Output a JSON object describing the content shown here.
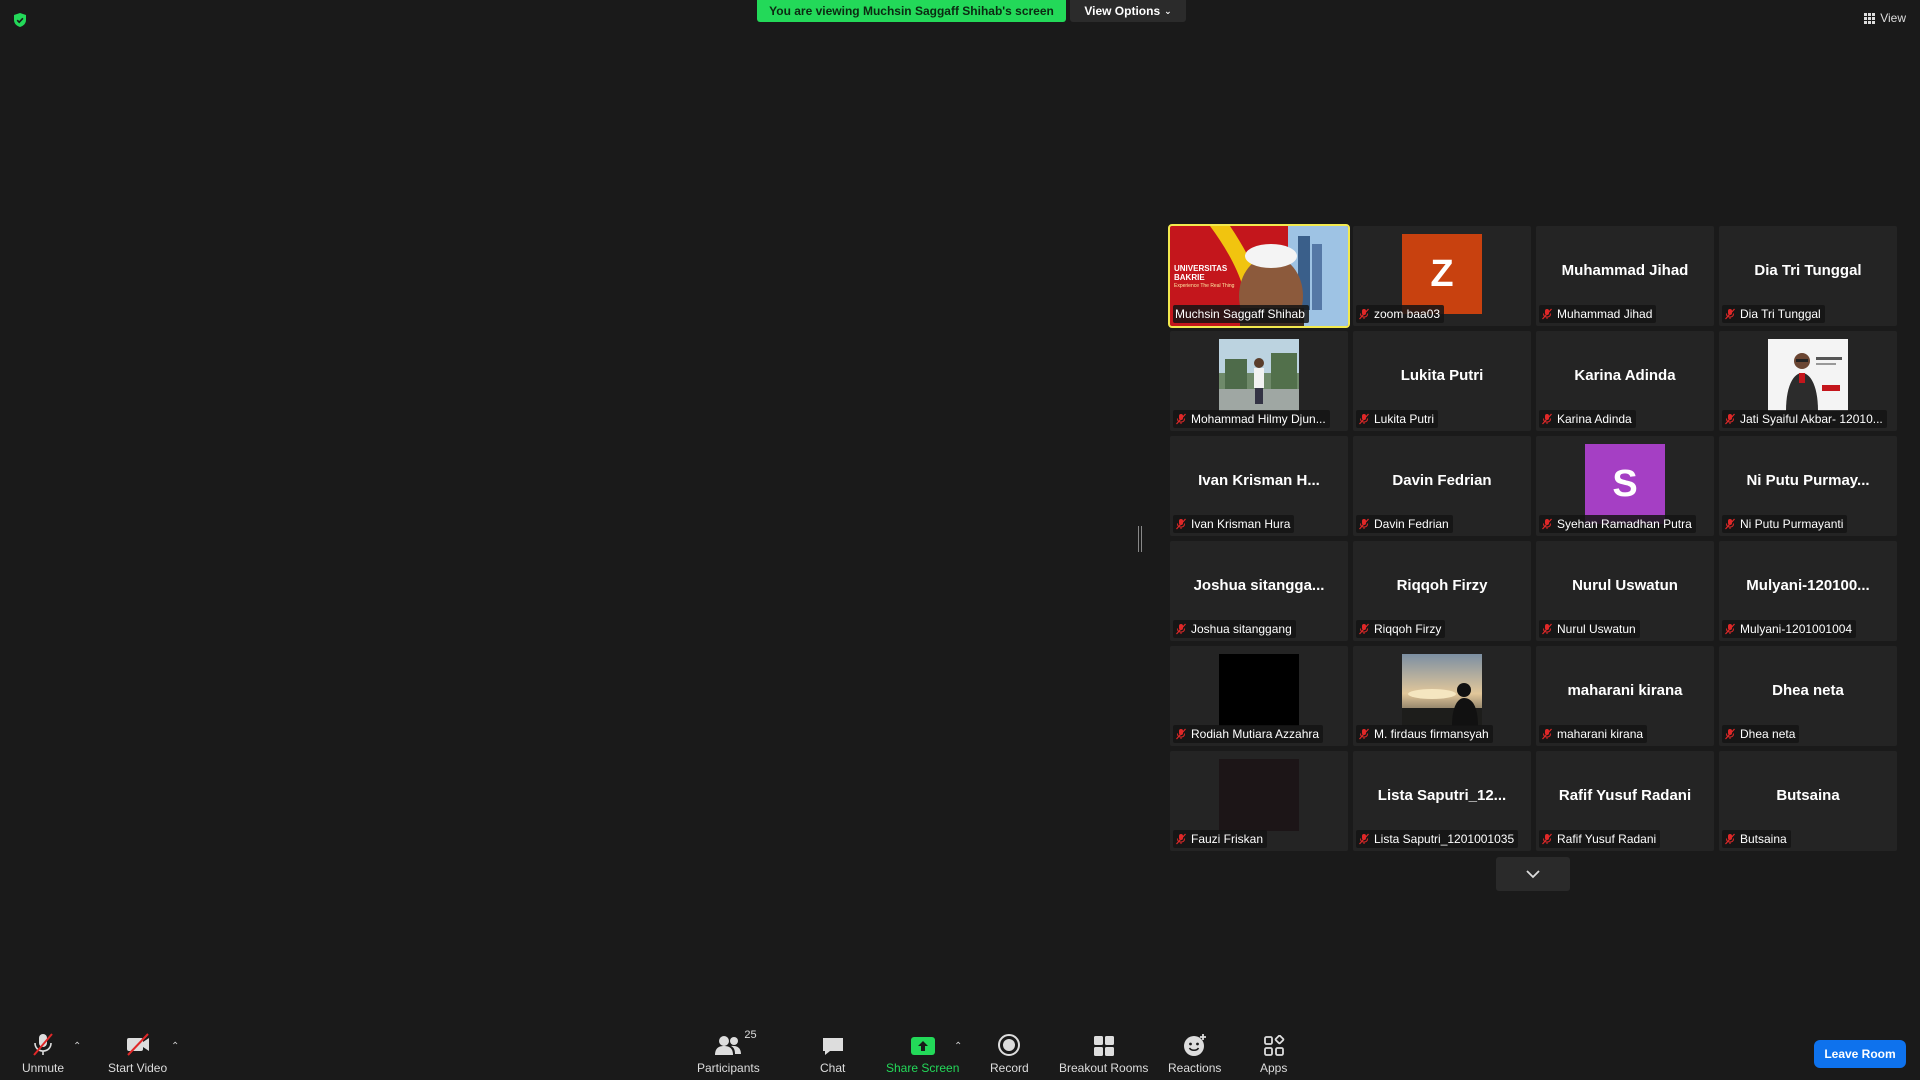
{
  "top": {
    "banner": "You are viewing Muchsin Saggaff Shihab's screen",
    "view_options": "View Options",
    "view": "View"
  },
  "gallery": {
    "tiles": [
      {
        "label": "Muchsin Saggaff Shihab",
        "big": "",
        "kind": "video",
        "muted": false
      },
      {
        "label": "zoom baa03",
        "big": "",
        "kind": "avatar",
        "letter": "Z",
        "avatar_color": "#c8410f",
        "muted": true
      },
      {
        "label": "Muhammad Jihad",
        "big": "Muhammad Jihad",
        "kind": "name",
        "muted": true
      },
      {
        "label": "Dia Tri Tunggal",
        "big": "Dia Tri Tunggal",
        "kind": "name",
        "muted": true
      },
      {
        "label": "Mohammad Hilmy Djun...",
        "big": "",
        "kind": "photo",
        "photo": "outdoor-person",
        "muted": true
      },
      {
        "label": "Lukita Putri",
        "big": "Lukita Putri",
        "kind": "name",
        "muted": true
      },
      {
        "label": "Karina Adinda",
        "big": "Karina Adinda",
        "kind": "name",
        "muted": true
      },
      {
        "label": "Jati Syaiful Akbar- 12010...",
        "big": "",
        "kind": "photo",
        "photo": "poster-person",
        "muted": true
      },
      {
        "label": "Ivan Krisman Hura",
        "big": "Ivan  Krisman  H...",
        "kind": "name",
        "muted": true
      },
      {
        "label": "Davin Fedrian",
        "big": "Davin Fedrian",
        "kind": "name",
        "muted": true
      },
      {
        "label": "Syehan Ramadhan Putra",
        "big": "",
        "kind": "avatar",
        "letter": "S",
        "avatar_color": "#a53fc4",
        "muted": true
      },
      {
        "label": "Ni Putu Purmayanti",
        "big": "Ni  Putu  Purmay...",
        "kind": "name",
        "muted": true
      },
      {
        "label": "Joshua sitanggang",
        "big": "Joshua  sitangga...",
        "kind": "name",
        "muted": true
      },
      {
        "label": "Riqqoh Firzy",
        "big": "Riqqoh Firzy",
        "kind": "name",
        "muted": true
      },
      {
        "label": "Nurul Uswatun",
        "big": "Nurul Uswatun",
        "kind": "name",
        "muted": true
      },
      {
        "label": "Mulyani-1201001004",
        "big": "Mulyani-120100...",
        "kind": "name",
        "muted": true
      },
      {
        "label": "Rodiah Mutiara Azzahra",
        "big": "",
        "kind": "photo",
        "photo": "black",
        "muted": true
      },
      {
        "label": "M. firdaus firmansyah",
        "big": "",
        "kind": "photo",
        "photo": "sunset-silhouette",
        "muted": true
      },
      {
        "label": "maharani kirana",
        "big": "maharani kirana",
        "kind": "name",
        "muted": true
      },
      {
        "label": "Dhea neta",
        "big": "Dhea neta",
        "kind": "name",
        "muted": true
      },
      {
        "label": "Fauzi Friskan",
        "big": "",
        "kind": "photo",
        "photo": "dark",
        "muted": true
      },
      {
        "label": "Lista Saputri_1201001035",
        "big": "Lista  Saputri_12...",
        "kind": "name",
        "muted": true
      },
      {
        "label": "Rafif Yusuf Radani",
        "big": "Rafif Yusuf Radani",
        "kind": "name",
        "muted": true
      },
      {
        "label": "Butsaina",
        "big": "Butsaina",
        "kind": "name",
        "muted": true
      }
    ],
    "video_banner": {
      "line1": "UNIVERSITAS",
      "line2": "BAKRIE",
      "line3": "Experience The Real Thing"
    }
  },
  "toolbar": {
    "unmute": "Unmute",
    "start_video": "Start Video",
    "participants": "Participants",
    "participants_count": "25",
    "chat": "Chat",
    "share_screen": "Share Screen",
    "record": "Record",
    "breakout_rooms": "Breakout Rooms",
    "reactions": "Reactions",
    "apps": "Apps",
    "leave_room": "Leave Room"
  },
  "colors": {
    "banner_green": "#23d959",
    "active_speaker": "#f2e94e",
    "leave_blue": "#0e72ed",
    "mute_red": "#e02828"
  }
}
